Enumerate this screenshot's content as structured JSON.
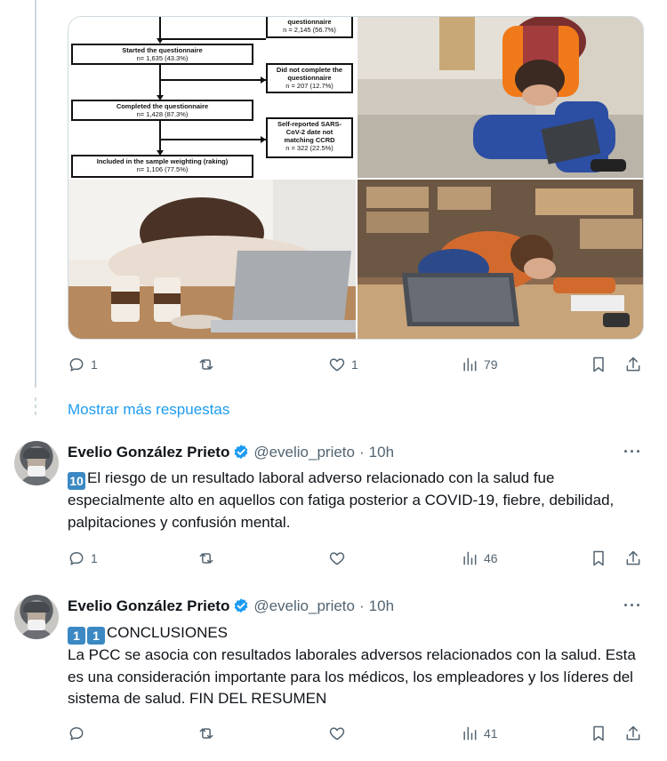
{
  "media": {
    "flowchart": {
      "box_not_started_line1": "questionnaire",
      "box_not_started_line2": "n = 2,145 (56.7%)",
      "box_started_title": "Started the questionnaire",
      "box_started_n": "n= 1,635 (43.3%)",
      "box_not_completed_line1": "Did not complete the",
      "box_not_completed_line2": "questionnaire",
      "box_not_completed_n": "n = 207 (12.7%)",
      "box_completed_title": "Completed the questionnaire",
      "box_completed_n": "n= 1,428 (87.3%)",
      "box_selfreported_line1": "Self-reported SARS-",
      "box_selfreported_line2": "CoV-2 date not",
      "box_selfreported_line3": "matching CCRD",
      "box_selfreported_n": "n = 322 (22.5%)",
      "box_included_title": "Included in the sample weighting (raking)",
      "box_included_n": "n= 1,106 (77.5%)"
    }
  },
  "tweet0_actions": {
    "replies": "1",
    "retweets": "",
    "likes": "1",
    "views": "79"
  },
  "show_more_replies": "Mostrar más respuestas",
  "tweets": [
    {
      "name": "Evelio González Prieto",
      "handle": "@evelio_prieto",
      "separator": "·",
      "time": "10h",
      "keycap": "10",
      "text": "El riesgo de un resultado laboral adverso relacionado con la salud fue especialmente alto en aquellos con fatiga posterior a COVID-19, fiebre, debilidad, palpitaciones y confusión mental.",
      "replies": "1",
      "retweets": "",
      "likes": "",
      "views": "46"
    },
    {
      "name": "Evelio González Prieto",
      "handle": "@evelio_prieto",
      "separator": "·",
      "time": "10h",
      "keycap_a": "1",
      "keycap_b": "1",
      "heading": "CONCLUSIONES",
      "text": "La PCC se asocia con resultados laborales adversos relacionados con la salud. Esta es una consideración importante para los médicos, los empleadores y los líderes del sistema de salud. FIN DEL RESUMEN",
      "replies": "",
      "retweets": "",
      "likes": "",
      "views": "41"
    }
  ],
  "more_menu": "···",
  "colors": {
    "link": "#1d9bf0",
    "secondary_text": "#536471",
    "verified": "#1d9bf0",
    "keycap": "#3b88c3",
    "thread_line": "#cfd9de"
  }
}
